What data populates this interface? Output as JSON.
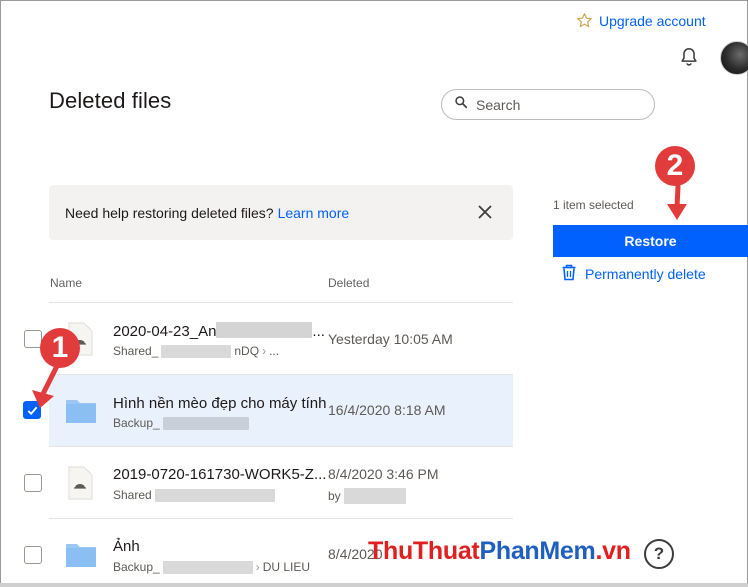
{
  "topbar": {
    "upgrade_label": "Upgrade account"
  },
  "page": {
    "title": "Deleted files"
  },
  "search": {
    "placeholder": "Search"
  },
  "help_banner": {
    "text": "Need help restoring deleted files?",
    "link": "Learn more"
  },
  "columns": {
    "name": "Name",
    "deleted": "Deleted"
  },
  "rows": [
    {
      "name": "2020-04-23_An",
      "name_suffix": "...",
      "location": "Shared_",
      "location_tail": "nDQ",
      "location_more": "...",
      "deleted": "Yesterday 10:05 AM",
      "type": "file",
      "checked": false
    },
    {
      "name": "Hình nền mèo đẹp cho máy tính",
      "location": "Backup_",
      "deleted": "16/4/2020 8:18 AM",
      "type": "folder",
      "checked": true
    },
    {
      "name": "2019-0720-161730-WORK5-Z...",
      "location": "Shared",
      "deleted": "8/4/2020 3:46 PM",
      "deleted_by": "by",
      "type": "file",
      "checked": false
    },
    {
      "name": "Ảnh",
      "location": "Backup_",
      "location_tail": "DU LIEU",
      "deleted": "8/4/2020",
      "type": "folder",
      "checked": false
    }
  ],
  "selection": {
    "count_text": "1 item selected",
    "restore_label": "Restore",
    "perm_delete_label": "Permanently delete"
  },
  "annotations": {
    "step1": "1",
    "step2": "2",
    "marker_color": "#e23b3b"
  },
  "watermark": {
    "part1": "ThuThuat",
    "part2": "PhanMem",
    "part3": ".vn"
  },
  "help_button": "?",
  "colors": {
    "accent": "#0061fe",
    "selected_row": "#e9f1fd",
    "banner_bg": "#f3f2f1"
  }
}
